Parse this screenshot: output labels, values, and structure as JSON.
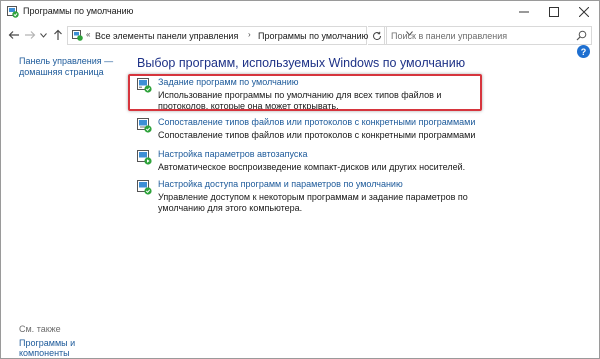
{
  "window": {
    "title": "Программы по умолчанию",
    "icons": {
      "app": "default-programs-icon",
      "minimize": "minimize-icon",
      "maximize": "maximize-icon",
      "close": "close-icon"
    }
  },
  "addressbar": {
    "back": "back-arrow-icon",
    "forward": "forward-arrow-icon",
    "recent": "chevron-down-icon",
    "up": "up-arrow-icon",
    "prefix": "«",
    "breadcrumb": [
      "Все элементы панели управления",
      "Программы по умолчанию"
    ],
    "separator": "›",
    "search_placeholder": "Поиск в панели управления"
  },
  "sidebar": {
    "home_link": "Панель управления — домашняя страница",
    "see_also_label": "См. также",
    "see_also_items": [
      "Программы и компоненты"
    ]
  },
  "main": {
    "title": "Выбор программ, используемых Windows по умолчанию",
    "tasks": [
      {
        "icon": "default-programs-icon",
        "link": "Задание программ по умолчанию",
        "description": "Использование программы по умолчанию для всех типов файлов и протоколов, которые она может открывать."
      },
      {
        "icon": "file-associations-icon",
        "link": "Сопоставление типов файлов или протоколов с конкретными программами",
        "description": "Сопоставление типов файлов или протоколов с конкретными программами"
      },
      {
        "icon": "autoplay-icon",
        "link": "Настройка параметров автозапуска",
        "description": "Автоматическое воспроизведение компакт-дисков или других носителей."
      },
      {
        "icon": "program-access-icon",
        "link": "Настройка доступа программ и параметров по умолчанию",
        "description": "Управление доступом к некоторым программам и задание параметров по умолчанию для этого компьютера."
      }
    ],
    "highlight_color": "#d6353d",
    "link_color": "#1d5a9a",
    "title_color": "#1e3287"
  }
}
